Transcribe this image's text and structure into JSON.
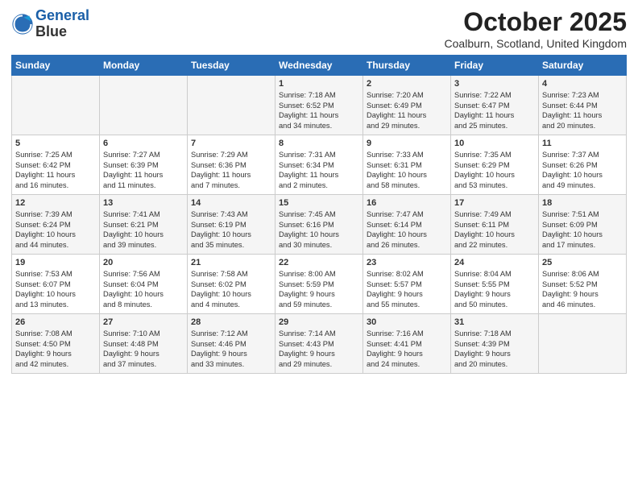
{
  "logo": {
    "line1": "General",
    "line2": "Blue"
  },
  "title": "October 2025",
  "location": "Coalburn, Scotland, United Kingdom",
  "days_of_week": [
    "Sunday",
    "Monday",
    "Tuesday",
    "Wednesday",
    "Thursday",
    "Friday",
    "Saturday"
  ],
  "weeks": [
    [
      {
        "day": "",
        "content": ""
      },
      {
        "day": "",
        "content": ""
      },
      {
        "day": "",
        "content": ""
      },
      {
        "day": "1",
        "content": "Sunrise: 7:18 AM\nSunset: 6:52 PM\nDaylight: 11 hours\nand 34 minutes."
      },
      {
        "day": "2",
        "content": "Sunrise: 7:20 AM\nSunset: 6:49 PM\nDaylight: 11 hours\nand 29 minutes."
      },
      {
        "day": "3",
        "content": "Sunrise: 7:22 AM\nSunset: 6:47 PM\nDaylight: 11 hours\nand 25 minutes."
      },
      {
        "day": "4",
        "content": "Sunrise: 7:23 AM\nSunset: 6:44 PM\nDaylight: 11 hours\nand 20 minutes."
      }
    ],
    [
      {
        "day": "5",
        "content": "Sunrise: 7:25 AM\nSunset: 6:42 PM\nDaylight: 11 hours\nand 16 minutes."
      },
      {
        "day": "6",
        "content": "Sunrise: 7:27 AM\nSunset: 6:39 PM\nDaylight: 11 hours\nand 11 minutes."
      },
      {
        "day": "7",
        "content": "Sunrise: 7:29 AM\nSunset: 6:36 PM\nDaylight: 11 hours\nand 7 minutes."
      },
      {
        "day": "8",
        "content": "Sunrise: 7:31 AM\nSunset: 6:34 PM\nDaylight: 11 hours\nand 2 minutes."
      },
      {
        "day": "9",
        "content": "Sunrise: 7:33 AM\nSunset: 6:31 PM\nDaylight: 10 hours\nand 58 minutes."
      },
      {
        "day": "10",
        "content": "Sunrise: 7:35 AM\nSunset: 6:29 PM\nDaylight: 10 hours\nand 53 minutes."
      },
      {
        "day": "11",
        "content": "Sunrise: 7:37 AM\nSunset: 6:26 PM\nDaylight: 10 hours\nand 49 minutes."
      }
    ],
    [
      {
        "day": "12",
        "content": "Sunrise: 7:39 AM\nSunset: 6:24 PM\nDaylight: 10 hours\nand 44 minutes."
      },
      {
        "day": "13",
        "content": "Sunrise: 7:41 AM\nSunset: 6:21 PM\nDaylight: 10 hours\nand 39 minutes."
      },
      {
        "day": "14",
        "content": "Sunrise: 7:43 AM\nSunset: 6:19 PM\nDaylight: 10 hours\nand 35 minutes."
      },
      {
        "day": "15",
        "content": "Sunrise: 7:45 AM\nSunset: 6:16 PM\nDaylight: 10 hours\nand 30 minutes."
      },
      {
        "day": "16",
        "content": "Sunrise: 7:47 AM\nSunset: 6:14 PM\nDaylight: 10 hours\nand 26 minutes."
      },
      {
        "day": "17",
        "content": "Sunrise: 7:49 AM\nSunset: 6:11 PM\nDaylight: 10 hours\nand 22 minutes."
      },
      {
        "day": "18",
        "content": "Sunrise: 7:51 AM\nSunset: 6:09 PM\nDaylight: 10 hours\nand 17 minutes."
      }
    ],
    [
      {
        "day": "19",
        "content": "Sunrise: 7:53 AM\nSunset: 6:07 PM\nDaylight: 10 hours\nand 13 minutes."
      },
      {
        "day": "20",
        "content": "Sunrise: 7:56 AM\nSunset: 6:04 PM\nDaylight: 10 hours\nand 8 minutes."
      },
      {
        "day": "21",
        "content": "Sunrise: 7:58 AM\nSunset: 6:02 PM\nDaylight: 10 hours\nand 4 minutes."
      },
      {
        "day": "22",
        "content": "Sunrise: 8:00 AM\nSunset: 5:59 PM\nDaylight: 9 hours\nand 59 minutes."
      },
      {
        "day": "23",
        "content": "Sunrise: 8:02 AM\nSunset: 5:57 PM\nDaylight: 9 hours\nand 55 minutes."
      },
      {
        "day": "24",
        "content": "Sunrise: 8:04 AM\nSunset: 5:55 PM\nDaylight: 9 hours\nand 50 minutes."
      },
      {
        "day": "25",
        "content": "Sunrise: 8:06 AM\nSunset: 5:52 PM\nDaylight: 9 hours\nand 46 minutes."
      }
    ],
    [
      {
        "day": "26",
        "content": "Sunrise: 7:08 AM\nSunset: 4:50 PM\nDaylight: 9 hours\nand 42 minutes."
      },
      {
        "day": "27",
        "content": "Sunrise: 7:10 AM\nSunset: 4:48 PM\nDaylight: 9 hours\nand 37 minutes."
      },
      {
        "day": "28",
        "content": "Sunrise: 7:12 AM\nSunset: 4:46 PM\nDaylight: 9 hours\nand 33 minutes."
      },
      {
        "day": "29",
        "content": "Sunrise: 7:14 AM\nSunset: 4:43 PM\nDaylight: 9 hours\nand 29 minutes."
      },
      {
        "day": "30",
        "content": "Sunrise: 7:16 AM\nSunset: 4:41 PM\nDaylight: 9 hours\nand 24 minutes."
      },
      {
        "day": "31",
        "content": "Sunrise: 7:18 AM\nSunset: 4:39 PM\nDaylight: 9 hours\nand 20 minutes."
      },
      {
        "day": "",
        "content": ""
      }
    ]
  ]
}
